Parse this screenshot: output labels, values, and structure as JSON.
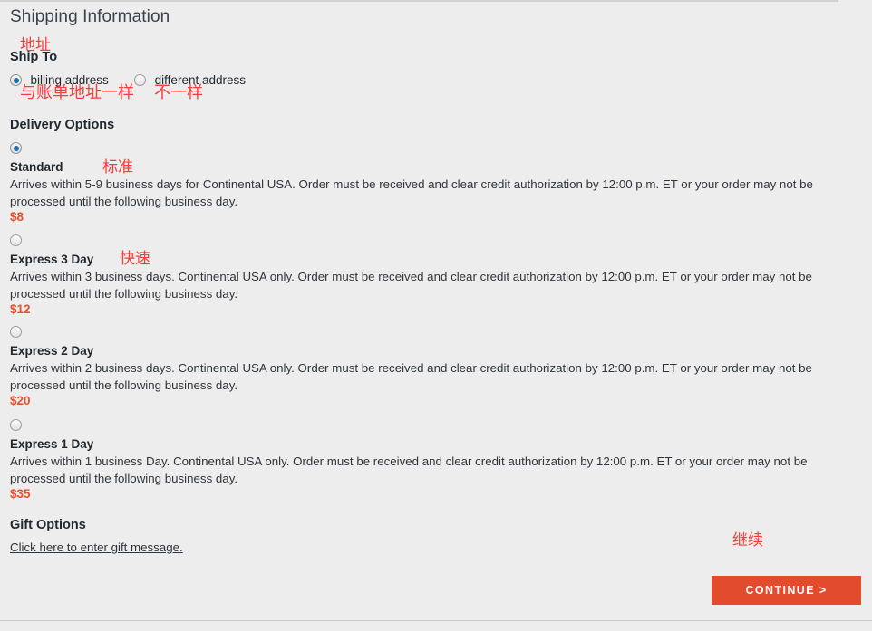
{
  "page": {
    "title": "Shipping Information",
    "accent_color": "#e24b2c",
    "price_color": "#e8502a",
    "annotation_color": "#fc3a3a",
    "background_color": "#ededed"
  },
  "ship_to": {
    "heading": "Ship To",
    "options": [
      {
        "label": "billing address",
        "checked": true
      },
      {
        "label": "different address",
        "checked": false
      }
    ]
  },
  "delivery": {
    "heading": "Delivery Options",
    "options": [
      {
        "name": "Standard",
        "description": "Arrives within 5-9 business days for Continental USA. Order must be received and clear credit authorization by 12:00 p.m. ET or your order may not be processed until the following business day.",
        "price": "$8",
        "checked": true
      },
      {
        "name": "Express 3 Day",
        "description": "Arrives within 3 business days. Continental USA only. Order must be received and clear credit authorization by 12:00 p.m. ET or your order may not be processed until the following business day.",
        "price": "$12",
        "checked": false
      },
      {
        "name": "Express 2 Day",
        "description": "Arrives within 2 business days. Continental USA only. Order must be received and clear credit authorization by 12:00 p.m. ET or your order may not be processed until the following business day.",
        "price": "$20",
        "checked": false
      },
      {
        "name": "Express 1 Day",
        "description": "Arrives within 1 business Day. Continental USA only. Order must be received and clear credit authorization by 12:00 p.m. ET or your order may not be processed until the following business day.",
        "price": "$35",
        "checked": false
      }
    ]
  },
  "gift": {
    "heading": "Gift Options",
    "link_label": "Click here to enter gift message."
  },
  "footer": {
    "continue_label": "CONTINUE >"
  },
  "annotations": {
    "address": "地址",
    "same_as_billing": "与账单地址一样",
    "different": "不一样",
    "standard": "标准",
    "express": "快速",
    "continue": "继续"
  }
}
